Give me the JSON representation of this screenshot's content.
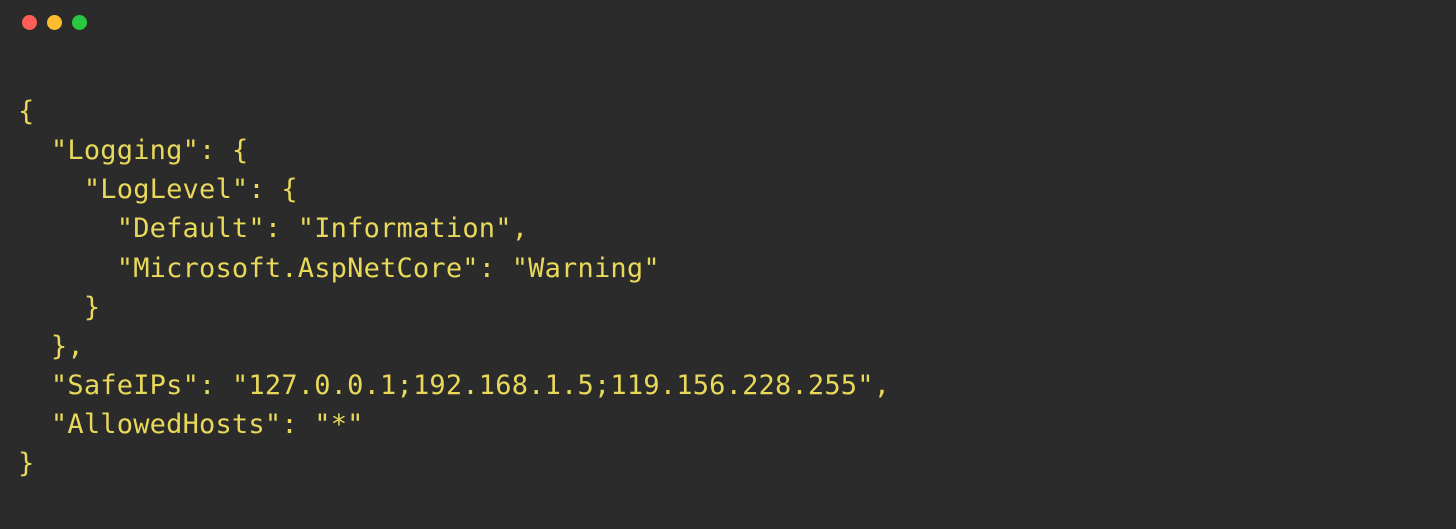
{
  "window": {
    "traffic_lights": {
      "close_color": "#ff5f57",
      "minimize_color": "#febc2e",
      "maximize_color": "#28c840"
    }
  },
  "code": {
    "lines": [
      {
        "indent": 0,
        "tokens": [
          {
            "t": "punct",
            "v": "{"
          }
        ]
      },
      {
        "indent": 1,
        "tokens": [
          {
            "t": "key",
            "v": "\"Logging\""
          },
          {
            "t": "colon",
            "v": ": "
          },
          {
            "t": "punct",
            "v": "{"
          }
        ]
      },
      {
        "indent": 2,
        "tokens": [
          {
            "t": "key",
            "v": "\"LogLevel\""
          },
          {
            "t": "colon",
            "v": ": "
          },
          {
            "t": "punct",
            "v": "{"
          }
        ]
      },
      {
        "indent": 3,
        "tokens": [
          {
            "t": "key",
            "v": "\"Default\""
          },
          {
            "t": "colon",
            "v": ": "
          },
          {
            "t": "string",
            "v": "\"Information\""
          },
          {
            "t": "comma",
            "v": ","
          }
        ]
      },
      {
        "indent": 3,
        "tokens": [
          {
            "t": "key",
            "v": "\"Microsoft.AspNetCore\""
          },
          {
            "t": "colon",
            "v": ": "
          },
          {
            "t": "string",
            "v": "\"Warning\""
          }
        ]
      },
      {
        "indent": 2,
        "tokens": [
          {
            "t": "punct",
            "v": "}"
          }
        ]
      },
      {
        "indent": 1,
        "tokens": [
          {
            "t": "punct",
            "v": "}"
          },
          {
            "t": "comma",
            "v": ","
          }
        ]
      },
      {
        "indent": 1,
        "tokens": [
          {
            "t": "key",
            "v": "\"SafeIPs\""
          },
          {
            "t": "colon",
            "v": ": "
          },
          {
            "t": "string",
            "v": "\"127.0.0.1;192.168.1.5;119.156.228.255\""
          },
          {
            "t": "comma",
            "v": ","
          }
        ]
      },
      {
        "indent": 1,
        "tokens": [
          {
            "t": "key",
            "v": "\"AllowedHosts\""
          },
          {
            "t": "colon",
            "v": ": "
          },
          {
            "t": "string",
            "v": "\"*\""
          }
        ]
      },
      {
        "indent": 0,
        "tokens": [
          {
            "t": "punct",
            "v": "}"
          }
        ]
      }
    ],
    "indent_unit": "  ",
    "json_value": {
      "Logging": {
        "LogLevel": {
          "Default": "Information",
          "Microsoft.AspNetCore": "Warning"
        }
      },
      "SafeIPs": "127.0.0.1;192.168.1.5;119.156.228.255",
      "AllowedHosts": "*"
    }
  }
}
